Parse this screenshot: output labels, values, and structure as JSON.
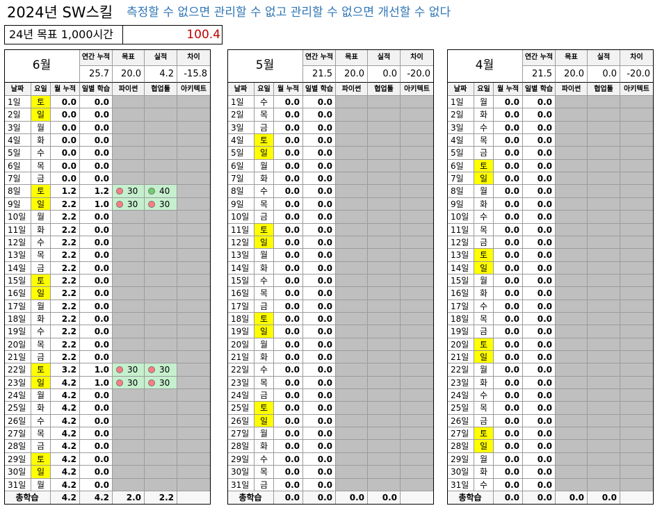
{
  "title": {
    "main": "2024년 SW스킬",
    "slogan": "측정할 수 없으면  관리할 수 없고 관리할 수 없으면 개선할 수 없다"
  },
  "goal": {
    "label": "24년 목표 1,000시간",
    "value": "100.4"
  },
  "headers": {
    "annual": "연간 누적",
    "target": "목표",
    "actual": "실적",
    "diff": "차이",
    "date": "날짜",
    "dow": "요일",
    "cum": "월 누적",
    "daily": "일별 학습",
    "python": "파이썬",
    "collab": "협업툴",
    "arch": "아키텍트",
    "total": "총학습"
  },
  "colors": {
    "weekend": "#ffff00",
    "good": "#c6efce",
    "accent": "#2e75b6",
    "goal": "#c00000",
    "empty": "#bfbfbf"
  },
  "months": [
    {
      "name": "6월",
      "annual": "25.7",
      "target": "20.0",
      "actual": "4.2",
      "diff": "-15.8",
      "total": {
        "cum": "4.2",
        "daily": "4.2",
        "python": "2.0",
        "collab": "2.2",
        "arch": ""
      },
      "days": [
        {
          "d": "1일",
          "w": "토",
          "cum": "0.0",
          "daily": "0.0",
          "py": "",
          "co": ""
        },
        {
          "d": "2일",
          "w": "일",
          "cum": "0.0",
          "daily": "0.0",
          "py": "",
          "co": ""
        },
        {
          "d": "3일",
          "w": "월",
          "cum": "0.0",
          "daily": "0.0",
          "py": "",
          "co": ""
        },
        {
          "d": "4일",
          "w": "화",
          "cum": "0.0",
          "daily": "0.0",
          "py": "",
          "co": ""
        },
        {
          "d": "5일",
          "w": "수",
          "cum": "0.0",
          "daily": "0.0",
          "py": "",
          "co": ""
        },
        {
          "d": "6일",
          "w": "목",
          "cum": "0.0",
          "daily": "0.0",
          "py": "",
          "co": ""
        },
        {
          "d": "7일",
          "w": "금",
          "cum": "0.0",
          "daily": "0.0",
          "py": "",
          "co": ""
        },
        {
          "d": "8일",
          "w": "토",
          "cum": "1.2",
          "daily": "1.2",
          "py": "30",
          "pyc": "red",
          "co": "40",
          "coc": "green"
        },
        {
          "d": "9일",
          "w": "일",
          "cum": "2.2",
          "daily": "1.0",
          "py": "30",
          "pyc": "red",
          "co": "30",
          "coc": "red"
        },
        {
          "d": "10일",
          "w": "월",
          "cum": "2.2",
          "daily": "0.0",
          "py": "",
          "co": ""
        },
        {
          "d": "11일",
          "w": "화",
          "cum": "2.2",
          "daily": "0.0",
          "py": "",
          "co": ""
        },
        {
          "d": "12일",
          "w": "수",
          "cum": "2.2",
          "daily": "0.0",
          "py": "",
          "co": ""
        },
        {
          "d": "13일",
          "w": "목",
          "cum": "2.2",
          "daily": "0.0",
          "py": "",
          "co": ""
        },
        {
          "d": "14일",
          "w": "금",
          "cum": "2.2",
          "daily": "0.0",
          "py": "",
          "co": ""
        },
        {
          "d": "15일",
          "w": "토",
          "cum": "2.2",
          "daily": "0.0",
          "py": "",
          "co": ""
        },
        {
          "d": "16일",
          "w": "일",
          "cum": "2.2",
          "daily": "0.0",
          "py": "",
          "co": ""
        },
        {
          "d": "17일",
          "w": "월",
          "cum": "2.2",
          "daily": "0.0",
          "py": "",
          "co": ""
        },
        {
          "d": "18일",
          "w": "화",
          "cum": "2.2",
          "daily": "0.0",
          "py": "",
          "co": ""
        },
        {
          "d": "19일",
          "w": "수",
          "cum": "2.2",
          "daily": "0.0",
          "py": "",
          "co": ""
        },
        {
          "d": "20일",
          "w": "목",
          "cum": "2.2",
          "daily": "0.0",
          "py": "",
          "co": ""
        },
        {
          "d": "21일",
          "w": "금",
          "cum": "2.2",
          "daily": "0.0",
          "py": "",
          "co": ""
        },
        {
          "d": "22일",
          "w": "토",
          "cum": "3.2",
          "daily": "1.0",
          "py": "30",
          "pyc": "red",
          "co": "30",
          "coc": "red"
        },
        {
          "d": "23일",
          "w": "일",
          "cum": "4.2",
          "daily": "1.0",
          "py": "30",
          "pyc": "red",
          "co": "30",
          "coc": "red"
        },
        {
          "d": "24일",
          "w": "월",
          "cum": "4.2",
          "daily": "0.0",
          "py": "",
          "co": ""
        },
        {
          "d": "25일",
          "w": "화",
          "cum": "4.2",
          "daily": "0.0",
          "py": "",
          "co": ""
        },
        {
          "d": "26일",
          "w": "수",
          "cum": "4.2",
          "daily": "0.0",
          "py": "",
          "co": ""
        },
        {
          "d": "27일",
          "w": "목",
          "cum": "4.2",
          "daily": "0.0",
          "py": "",
          "co": ""
        },
        {
          "d": "28일",
          "w": "금",
          "cum": "4.2",
          "daily": "0.0",
          "py": "",
          "co": ""
        },
        {
          "d": "29일",
          "w": "토",
          "cum": "4.2",
          "daily": "0.0",
          "py": "",
          "co": ""
        },
        {
          "d": "30일",
          "w": "일",
          "cum": "4.2",
          "daily": "0.0",
          "py": "",
          "co": ""
        },
        {
          "d": "31일",
          "w": "월",
          "cum": "4.2",
          "daily": "0.0",
          "py": "",
          "co": ""
        }
      ]
    },
    {
      "name": "5월",
      "annual": "21.5",
      "target": "20.0",
      "actual": "0.0",
      "diff": "-20.0",
      "total": {
        "cum": "0.0",
        "daily": "0.0",
        "python": "0.0",
        "collab": "0.0",
        "arch": ""
      },
      "days": [
        {
          "d": "1일",
          "w": "수",
          "cum": "0.0",
          "daily": "0.0",
          "py": "",
          "co": ""
        },
        {
          "d": "2일",
          "w": "목",
          "cum": "0.0",
          "daily": "0.0",
          "py": "",
          "co": ""
        },
        {
          "d": "3일",
          "w": "금",
          "cum": "0.0",
          "daily": "0.0",
          "py": "",
          "co": ""
        },
        {
          "d": "4일",
          "w": "토",
          "cum": "0.0",
          "daily": "0.0",
          "py": "",
          "co": ""
        },
        {
          "d": "5일",
          "w": "일",
          "cum": "0.0",
          "daily": "0.0",
          "py": "",
          "co": ""
        },
        {
          "d": "6일",
          "w": "월",
          "cum": "0.0",
          "daily": "0.0",
          "py": "",
          "co": ""
        },
        {
          "d": "7일",
          "w": "화",
          "cum": "0.0",
          "daily": "0.0",
          "py": "",
          "co": ""
        },
        {
          "d": "8일",
          "w": "수",
          "cum": "0.0",
          "daily": "0.0",
          "py": "",
          "co": ""
        },
        {
          "d": "9일",
          "w": "목",
          "cum": "0.0",
          "daily": "0.0",
          "py": "",
          "co": ""
        },
        {
          "d": "10일",
          "w": "금",
          "cum": "0.0",
          "daily": "0.0",
          "py": "",
          "co": ""
        },
        {
          "d": "11일",
          "w": "토",
          "cum": "0.0",
          "daily": "0.0",
          "py": "",
          "co": ""
        },
        {
          "d": "12일",
          "w": "일",
          "cum": "0.0",
          "daily": "0.0",
          "py": "",
          "co": ""
        },
        {
          "d": "13일",
          "w": "월",
          "cum": "0.0",
          "daily": "0.0",
          "py": "",
          "co": ""
        },
        {
          "d": "14일",
          "w": "화",
          "cum": "0.0",
          "daily": "0.0",
          "py": "",
          "co": ""
        },
        {
          "d": "15일",
          "w": "수",
          "cum": "0.0",
          "daily": "0.0",
          "py": "",
          "co": ""
        },
        {
          "d": "16일",
          "w": "목",
          "cum": "0.0",
          "daily": "0.0",
          "py": "",
          "co": ""
        },
        {
          "d": "17일",
          "w": "금",
          "cum": "0.0",
          "daily": "0.0",
          "py": "",
          "co": ""
        },
        {
          "d": "18일",
          "w": "토",
          "cum": "0.0",
          "daily": "0.0",
          "py": "",
          "co": ""
        },
        {
          "d": "19일",
          "w": "일",
          "cum": "0.0",
          "daily": "0.0",
          "py": "",
          "co": ""
        },
        {
          "d": "20일",
          "w": "월",
          "cum": "0.0",
          "daily": "0.0",
          "py": "",
          "co": ""
        },
        {
          "d": "21일",
          "w": "화",
          "cum": "0.0",
          "daily": "0.0",
          "py": "",
          "co": ""
        },
        {
          "d": "22일",
          "w": "수",
          "cum": "0.0",
          "daily": "0.0",
          "py": "",
          "co": ""
        },
        {
          "d": "23일",
          "w": "목",
          "cum": "0.0",
          "daily": "0.0",
          "py": "",
          "co": ""
        },
        {
          "d": "24일",
          "w": "금",
          "cum": "0.0",
          "daily": "0.0",
          "py": "",
          "co": ""
        },
        {
          "d": "25일",
          "w": "토",
          "cum": "0.0",
          "daily": "0.0",
          "py": "",
          "co": ""
        },
        {
          "d": "26일",
          "w": "일",
          "cum": "0.0",
          "daily": "0.0",
          "py": "",
          "co": ""
        },
        {
          "d": "27일",
          "w": "월",
          "cum": "0.0",
          "daily": "0.0",
          "py": "",
          "co": ""
        },
        {
          "d": "28일",
          "w": "화",
          "cum": "0.0",
          "daily": "0.0",
          "py": "",
          "co": ""
        },
        {
          "d": "29일",
          "w": "수",
          "cum": "0.0",
          "daily": "0.0",
          "py": "",
          "co": ""
        },
        {
          "d": "30일",
          "w": "목",
          "cum": "0.0",
          "daily": "0.0",
          "py": "",
          "co": ""
        },
        {
          "d": "31일",
          "w": "금",
          "cum": "0.0",
          "daily": "0.0",
          "py": "",
          "co": ""
        }
      ]
    },
    {
      "name": "4월",
      "annual": "21.5",
      "target": "20.0",
      "actual": "0.0",
      "diff": "-20.0",
      "total": {
        "cum": "0.0",
        "daily": "0.0",
        "python": "0.0",
        "collab": "0.0",
        "arch": ""
      },
      "days": [
        {
          "d": "1일",
          "w": "월",
          "cum": "0.0",
          "daily": "0.0",
          "py": "",
          "co": ""
        },
        {
          "d": "2일",
          "w": "화",
          "cum": "0.0",
          "daily": "0.0",
          "py": "",
          "co": ""
        },
        {
          "d": "3일",
          "w": "수",
          "cum": "0.0",
          "daily": "0.0",
          "py": "",
          "co": ""
        },
        {
          "d": "4일",
          "w": "목",
          "cum": "0.0",
          "daily": "0.0",
          "py": "",
          "co": ""
        },
        {
          "d": "5일",
          "w": "금",
          "cum": "0.0",
          "daily": "0.0",
          "py": "",
          "co": ""
        },
        {
          "d": "6일",
          "w": "토",
          "cum": "0.0",
          "daily": "0.0",
          "py": "",
          "co": ""
        },
        {
          "d": "7일",
          "w": "일",
          "cum": "0.0",
          "daily": "0.0",
          "py": "",
          "co": ""
        },
        {
          "d": "8일",
          "w": "월",
          "cum": "0.0",
          "daily": "0.0",
          "py": "",
          "co": ""
        },
        {
          "d": "9일",
          "w": "화",
          "cum": "0.0",
          "daily": "0.0",
          "py": "",
          "co": ""
        },
        {
          "d": "10일",
          "w": "수",
          "cum": "0.0",
          "daily": "0.0",
          "py": "",
          "co": ""
        },
        {
          "d": "11일",
          "w": "목",
          "cum": "0.0",
          "daily": "0.0",
          "py": "",
          "co": ""
        },
        {
          "d": "12일",
          "w": "금",
          "cum": "0.0",
          "daily": "0.0",
          "py": "",
          "co": ""
        },
        {
          "d": "13일",
          "w": "토",
          "cum": "0.0",
          "daily": "0.0",
          "py": "",
          "co": ""
        },
        {
          "d": "14일",
          "w": "일",
          "cum": "0.0",
          "daily": "0.0",
          "py": "",
          "co": ""
        },
        {
          "d": "15일",
          "w": "월",
          "cum": "0.0",
          "daily": "0.0",
          "py": "",
          "co": ""
        },
        {
          "d": "16일",
          "w": "화",
          "cum": "0.0",
          "daily": "0.0",
          "py": "",
          "co": ""
        },
        {
          "d": "17일",
          "w": "수",
          "cum": "0.0",
          "daily": "0.0",
          "py": "",
          "co": ""
        },
        {
          "d": "18일",
          "w": "목",
          "cum": "0.0",
          "daily": "0.0",
          "py": "",
          "co": ""
        },
        {
          "d": "19일",
          "w": "금",
          "cum": "0.0",
          "daily": "0.0",
          "py": "",
          "co": ""
        },
        {
          "d": "20일",
          "w": "토",
          "cum": "0.0",
          "daily": "0.0",
          "py": "",
          "co": ""
        },
        {
          "d": "21일",
          "w": "일",
          "cum": "0.0",
          "daily": "0.0",
          "py": "",
          "co": ""
        },
        {
          "d": "22일",
          "w": "월",
          "cum": "0.0",
          "daily": "0.0",
          "py": "",
          "co": ""
        },
        {
          "d": "23일",
          "w": "화",
          "cum": "0.0",
          "daily": "0.0",
          "py": "",
          "co": ""
        },
        {
          "d": "24일",
          "w": "수",
          "cum": "0.0",
          "daily": "0.0",
          "py": "",
          "co": ""
        },
        {
          "d": "25일",
          "w": "목",
          "cum": "0.0",
          "daily": "0.0",
          "py": "",
          "co": ""
        },
        {
          "d": "26일",
          "w": "금",
          "cum": "0.0",
          "daily": "0.0",
          "py": "",
          "co": ""
        },
        {
          "d": "27일",
          "w": "토",
          "cum": "0.0",
          "daily": "0.0",
          "py": "",
          "co": ""
        },
        {
          "d": "28일",
          "w": "일",
          "cum": "0.0",
          "daily": "0.0",
          "py": "",
          "co": ""
        },
        {
          "d": "29일",
          "w": "월",
          "cum": "0.0",
          "daily": "0.0",
          "py": "",
          "co": ""
        },
        {
          "d": "30일",
          "w": "화",
          "cum": "0.0",
          "daily": "0.0",
          "py": "",
          "co": ""
        },
        {
          "d": "31일",
          "w": "수",
          "cum": "0.0",
          "daily": "0.0",
          "py": "",
          "co": ""
        }
      ]
    }
  ]
}
